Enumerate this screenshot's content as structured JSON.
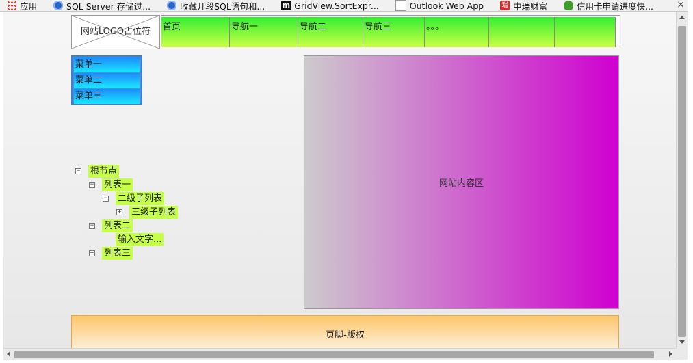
{
  "bookmarks": [
    {
      "label": "应用",
      "icon": "apps-grid-icon"
    },
    {
      "label": "SQL Server 存储过...",
      "icon": "globe-icon"
    },
    {
      "label": "收藏几段SQL语句和...",
      "icon": "globe-icon"
    },
    {
      "label": "GridView.SortExpr...",
      "icon": "m-logo-icon"
    },
    {
      "label": "Outlook Web App",
      "icon": "document-icon"
    },
    {
      "label": "中瑞财富",
      "icon": "rui-logo-icon"
    },
    {
      "label": "信用卡申请进度快...",
      "icon": "frog-icon"
    }
  ],
  "bookmarks_close": "×",
  "logo": {
    "label": "网站LOGO占位符"
  },
  "nav": {
    "items": [
      {
        "label": "首页",
        "width": 100
      },
      {
        "label": "导航一",
        "width": 100
      },
      {
        "label": "导航二",
        "width": 95
      },
      {
        "label": "导航三",
        "width": 90
      },
      {
        "label": "。。。",
        "width": 94
      },
      {
        "label": "",
        "width": 96
      },
      {
        "label": "",
        "width": 89
      }
    ]
  },
  "menu": {
    "items": [
      {
        "label": "菜单一"
      },
      {
        "label": "菜单二"
      },
      {
        "label": "菜单三"
      }
    ]
  },
  "tree": {
    "nodes": [
      {
        "label": "根节点",
        "level": 0,
        "expander": "⊟"
      },
      {
        "label": "列表一",
        "level": 1,
        "expander": "⊟"
      },
      {
        "label": "二级子列表",
        "level": 2,
        "expander": "⊟"
      },
      {
        "label": "三级子列表",
        "level": 3,
        "expander": "⊞"
      },
      {
        "label": "列表二",
        "level": 1,
        "expander": "⊟"
      },
      {
        "label": "输入文字...",
        "level": 2,
        "expander": ""
      },
      {
        "label": "列表三",
        "level": 1,
        "expander": "⊞"
      }
    ]
  },
  "content": {
    "label": "网站内容区"
  },
  "footer": {
    "label": "页脚-版权"
  },
  "colors": {
    "nav_gradient_top": "#33ee33",
    "nav_gradient_bottom": "#ccff44",
    "menu_gradient_top": "#1c8cff",
    "menu_gradient_bottom": "#19e6ff",
    "tree_label_bg": "#c6ff4a",
    "content_gradient_left": "#cdcbcd",
    "content_gradient_right": "#cf00cf",
    "footer_gradient_top": "#fdc66a",
    "footer_gradient_bottom": "#fdf0dc"
  }
}
